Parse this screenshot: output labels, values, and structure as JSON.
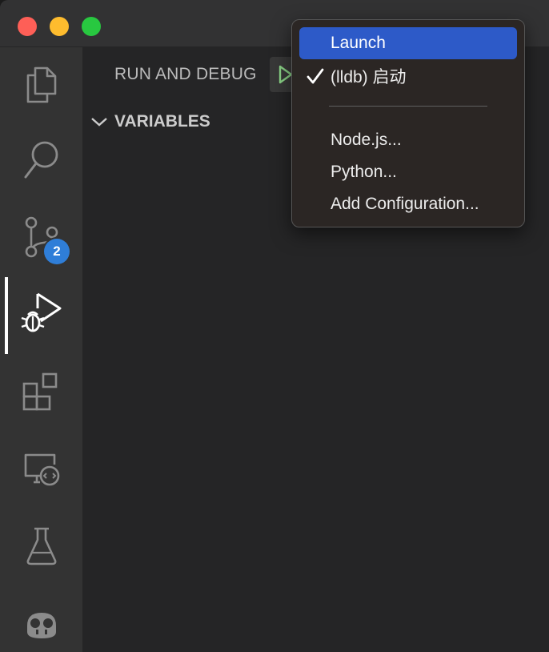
{
  "window": {
    "traffic_lights": [
      "close",
      "minimize",
      "zoom"
    ]
  },
  "activity_bar": {
    "items": [
      {
        "name": "explorer",
        "icon": "files-icon"
      },
      {
        "name": "search",
        "icon": "search-icon"
      },
      {
        "name": "source-control",
        "icon": "source-control-icon",
        "badge": "2"
      },
      {
        "name": "run-and-debug",
        "icon": "run-debug-icon",
        "active": true
      },
      {
        "name": "extensions",
        "icon": "extensions-icon"
      },
      {
        "name": "remote-explorer",
        "icon": "remote-explorer-icon"
      },
      {
        "name": "testing",
        "icon": "flask-icon"
      },
      {
        "name": "copilot",
        "icon": "copilot-icon"
      }
    ]
  },
  "sidebar": {
    "title": "RUN AND DEBUG",
    "sections": [
      {
        "label": "VARIABLES",
        "expanded": true
      }
    ]
  },
  "launch_menu": {
    "items": [
      {
        "label": "Launch",
        "highlighted": true,
        "checked": false
      },
      {
        "label": "(lldb) 启动",
        "highlighted": false,
        "checked": true
      },
      {
        "label": "Node.js...",
        "highlighted": false,
        "checked": false
      },
      {
        "label": "Python...",
        "highlighted": false,
        "checked": false
      },
      {
        "label": "Add Configuration...",
        "highlighted": false,
        "checked": false
      }
    ]
  },
  "colors": {
    "accent": "#2d5ac8",
    "badge": "#2f7ed8",
    "activity_bar": "#333333",
    "sidebar": "#252526",
    "run_green": "#89d185"
  }
}
